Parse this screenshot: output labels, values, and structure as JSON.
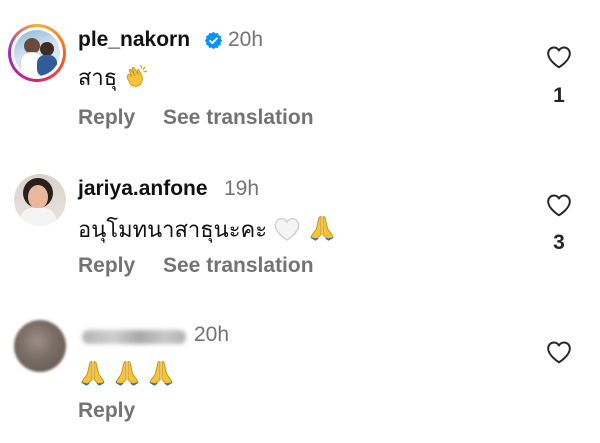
{
  "comments": [
    {
      "username": "ple_nakorn",
      "verified": true,
      "time": "20h",
      "text": "สาธุ",
      "emoji": [
        "clapping-hands"
      ],
      "like_count": "1",
      "actions": [
        "Reply",
        "See translation"
      ]
    },
    {
      "username": "jariya.anfone",
      "verified": false,
      "time": "19h",
      "text": "อนุโมทนาสาธุนะคะ",
      "emoji": [
        "white-heart",
        "folded-hands"
      ],
      "like_count": "3",
      "actions": [
        "Reply",
        "See translation"
      ]
    },
    {
      "username": "",
      "username_blurred": true,
      "verified": false,
      "time": "20h",
      "text": "",
      "emoji": [
        "folded-hands",
        "folded-hands",
        "folded-hands"
      ],
      "like_count": "",
      "actions": [
        "Reply"
      ]
    }
  ],
  "colors": {
    "text": "#111111",
    "secondary": "#737373",
    "verified_blue": "#0095f6"
  }
}
